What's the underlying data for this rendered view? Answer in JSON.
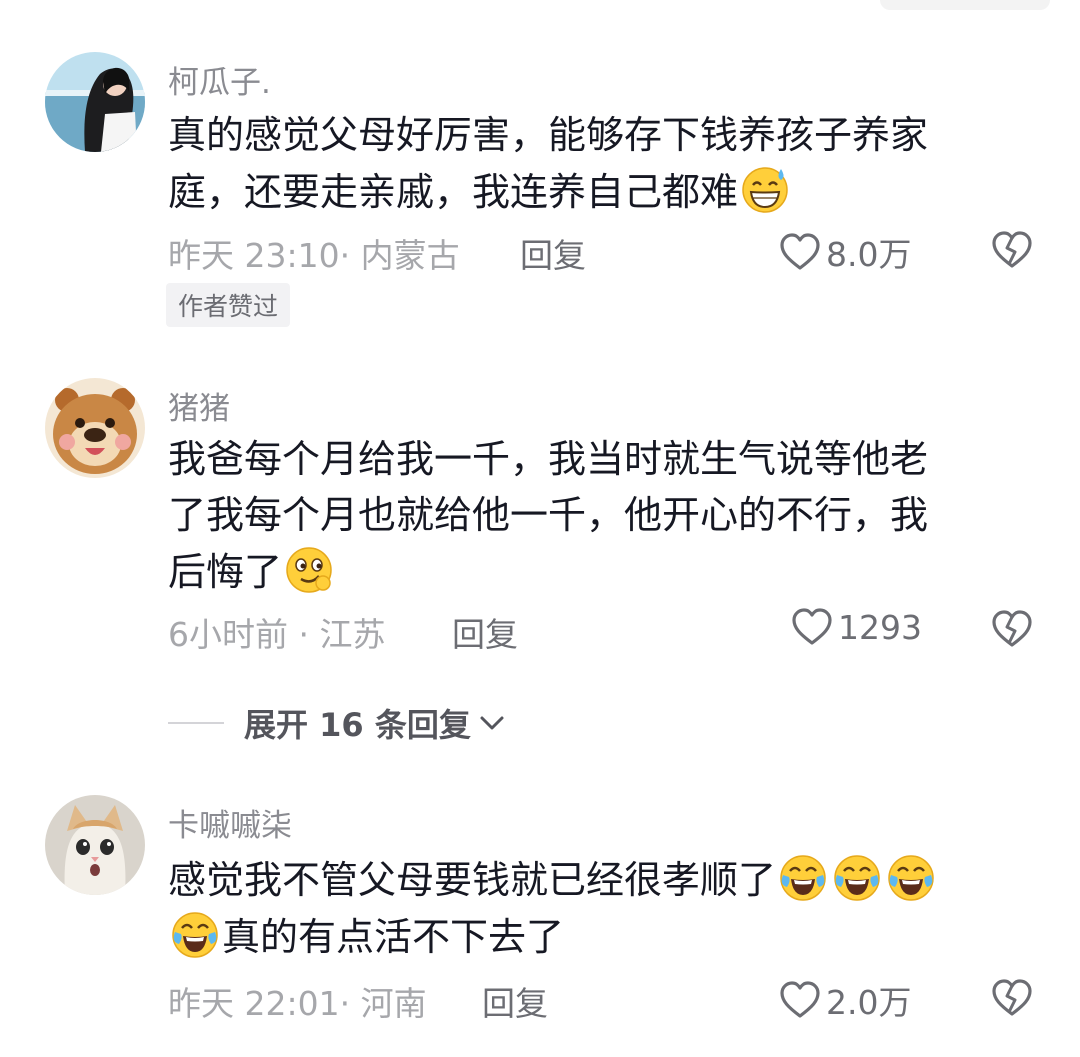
{
  "comments": [
    {
      "username": "柯瓜子.",
      "text_lines": [
        "真的感觉父母好厉害，能够存下钱养孩子养家",
        "庭，还要走亲戚，我连养自己都难"
      ],
      "time_location": "昨天 23:10· 内蒙古",
      "reply_label": "回复",
      "likes": "8.0万",
      "badge": "作者赞过"
    },
    {
      "username": "猪猪",
      "text_lines": [
        "我爸每个月给我一千，我当时就生气说等他老",
        "了我每个月也就给他一千，他开心的不行，我",
        "后悔了"
      ],
      "time_location": "6小时前 · 江苏",
      "reply_label": "回复",
      "likes": "1293"
    },
    {
      "username": "卡嘁嘁柒",
      "text_lines": [
        "感觉我不管父母要钱就已经很孝顺了",
        "真的有点活不下去了"
      ],
      "time_location": "昨天 22:01· 河南",
      "reply_label": "回复",
      "likes": "2.0万"
    }
  ],
  "expand_replies": "展开 16 条回复",
  "icons": {
    "like": "heart-outline-icon",
    "dislike": "broken-heart-icon",
    "emoji_1": "grinning-sweat-emoji",
    "emoji_2": "smirk-emoji",
    "emoji_3": "crying-laughing-emoji"
  }
}
